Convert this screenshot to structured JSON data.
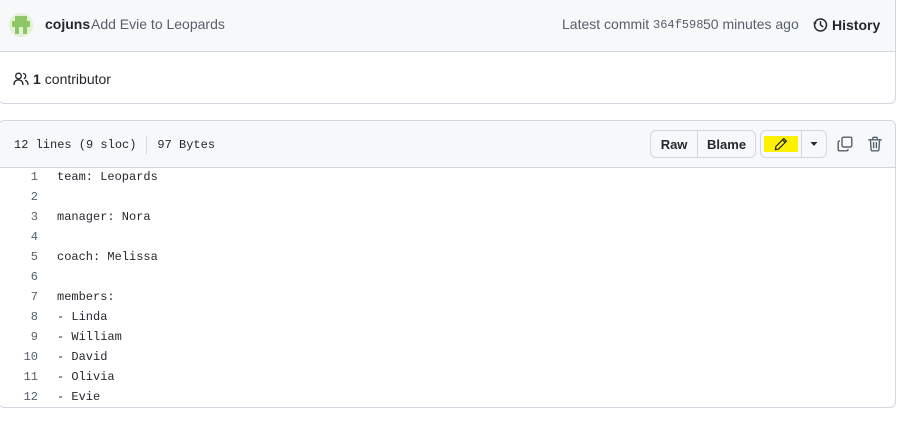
{
  "commit": {
    "author": "cojuns",
    "message": "Add Evie to Leopards",
    "latest_label": "Latest commit",
    "sha": "364f598",
    "time_ago": "50 minutes ago",
    "history_label": "History",
    "contributors_count": "1",
    "contributors_label": "contributor"
  },
  "file": {
    "lines_info": "12 lines (9 sloc)",
    "size": "97 Bytes",
    "buttons": {
      "raw": "Raw",
      "blame": "Blame"
    },
    "highlight_color": "#fff200",
    "code_lines": [
      {
        "num": "1",
        "text": "team: Leopards"
      },
      {
        "num": "2",
        "text": ""
      },
      {
        "num": "3",
        "text": "manager: Nora"
      },
      {
        "num": "4",
        "text": ""
      },
      {
        "num": "5",
        "text": "coach: Melissa"
      },
      {
        "num": "6",
        "text": ""
      },
      {
        "num": "7",
        "text": "members:"
      },
      {
        "num": "8",
        "text": "- Linda"
      },
      {
        "num": "9",
        "text": "- William"
      },
      {
        "num": "10",
        "text": "- David"
      },
      {
        "num": "11",
        "text": "- Olivia"
      },
      {
        "num": "12",
        "text": "- Evie"
      }
    ]
  },
  "icons": [
    "avatar",
    "history-icon",
    "people-icon",
    "pencil-icon",
    "triangle-down-icon",
    "copy-icon",
    "trash-icon"
  ]
}
